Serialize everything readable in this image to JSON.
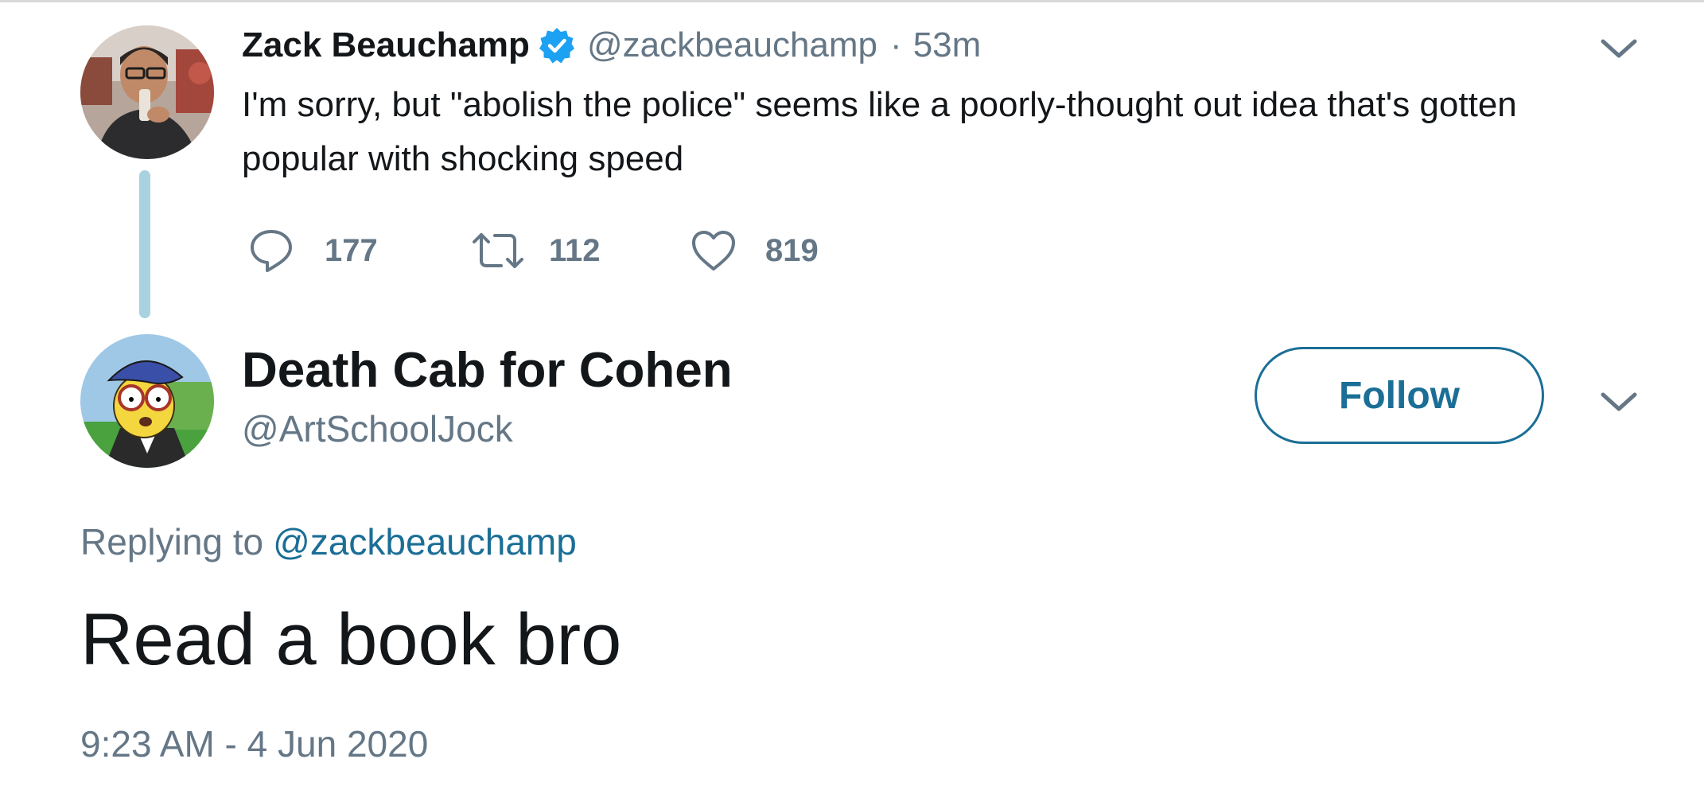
{
  "parent_tweet": {
    "author_name": "Zack Beauchamp",
    "verified": true,
    "handle": "@zackbeauchamp",
    "separator": "·",
    "time_ago": "53m",
    "text": "I'm sorry, but \"abolish the police\" seems like a poorly-thought out idea that's gotten popular with shocking speed",
    "actions": {
      "reply_count": "177",
      "retweet_count": "112",
      "like_count": "819"
    },
    "icons": {
      "verified": "verified-badge-icon",
      "reply": "speech-bubble-icon",
      "retweet": "retweet-arrows-icon",
      "like": "heart-outline-icon",
      "menu": "chevron-down-icon"
    }
  },
  "reply_tweet": {
    "author_name": "Death Cab for Cohen",
    "handle": "@ArtSchoolJock",
    "follow_label": "Follow",
    "replying_to_label": "Replying to",
    "replying_to_handle": "@zackbeauchamp",
    "text": "Read a book bro",
    "timestamp": "9:23 AM - 4 Jun 2020",
    "icons": {
      "menu": "chevron-down-icon"
    }
  },
  "colors": {
    "text_primary": "#14171a",
    "text_secondary": "#657786",
    "link": "#1b6e96",
    "verified_badge": "#1da1f2",
    "thread_line": "#a8d2e0",
    "background": "#ffffff"
  }
}
